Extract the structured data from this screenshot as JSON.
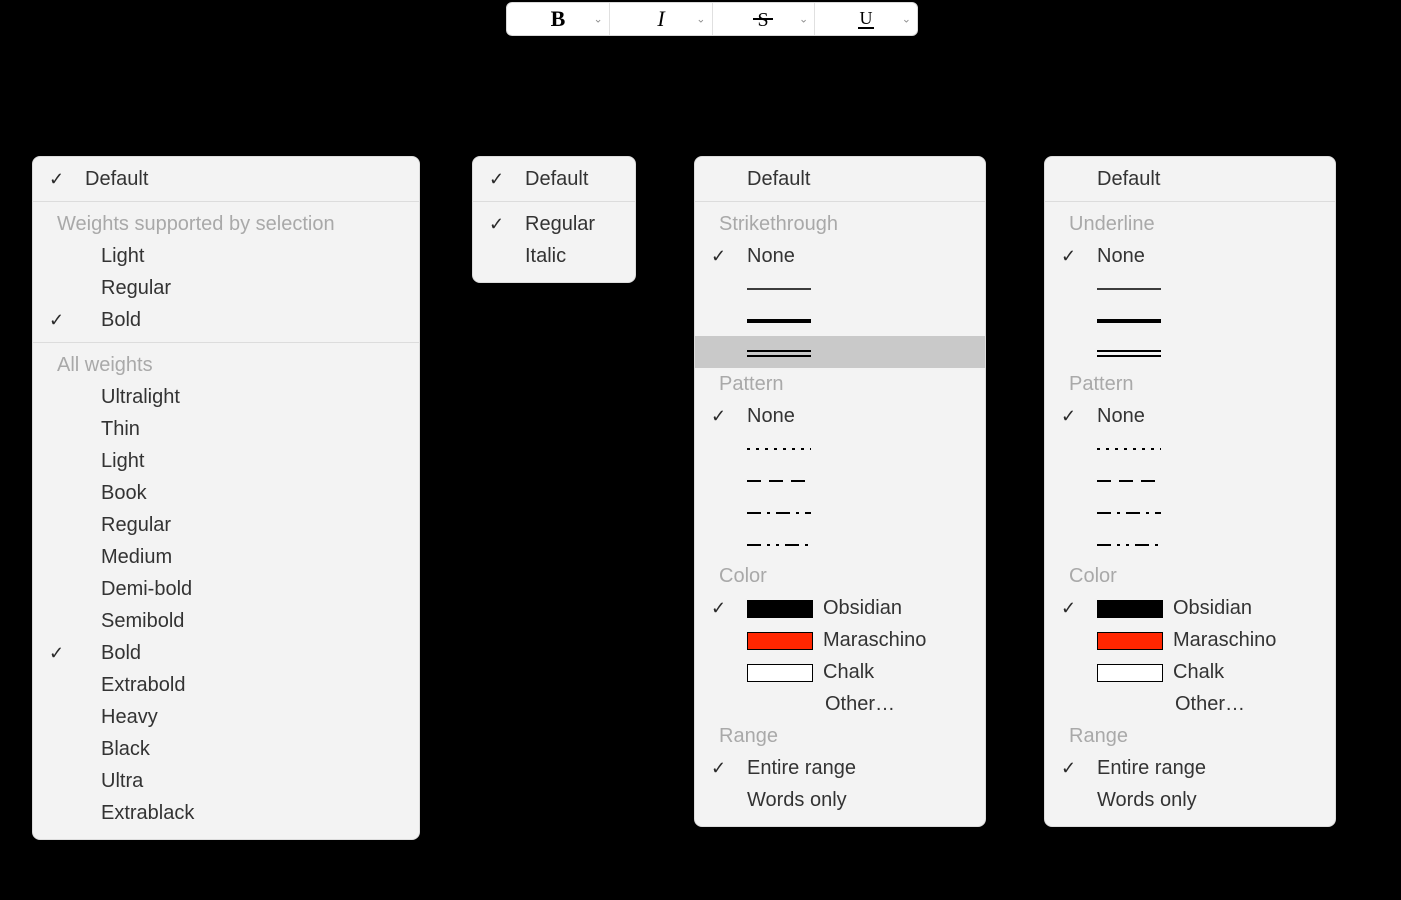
{
  "toolbar": {
    "segments": [
      {
        "name": "bold",
        "glyph": "B"
      },
      {
        "name": "italic",
        "glyph": "I"
      },
      {
        "name": "strikethrough",
        "glyph": "S"
      },
      {
        "name": "underline",
        "glyph": "U"
      }
    ]
  },
  "boldMenu": {
    "default": {
      "label": "Default",
      "checked": true
    },
    "supportedHeader": "Weights supported by selection",
    "supported": [
      {
        "label": "Light",
        "checked": false
      },
      {
        "label": "Regular",
        "checked": false
      },
      {
        "label": "Bold",
        "checked": true
      }
    ],
    "allHeader": "All weights",
    "all": [
      {
        "label": "Ultralight",
        "checked": false
      },
      {
        "label": "Thin",
        "checked": false
      },
      {
        "label": "Light",
        "checked": false
      },
      {
        "label": "Book",
        "checked": false
      },
      {
        "label": "Regular",
        "checked": false
      },
      {
        "label": "Medium",
        "checked": false
      },
      {
        "label": "Demi-bold",
        "checked": false
      },
      {
        "label": "Semibold",
        "checked": false
      },
      {
        "label": "Bold",
        "checked": true
      },
      {
        "label": "Extrabold",
        "checked": false
      },
      {
        "label": "Heavy",
        "checked": false
      },
      {
        "label": "Black",
        "checked": false
      },
      {
        "label": "Ultra",
        "checked": false
      },
      {
        "label": "Extrablack",
        "checked": false
      }
    ]
  },
  "italicMenu": {
    "default": {
      "label": "Default",
      "checked": true
    },
    "items": [
      {
        "label": "Regular",
        "checked": true
      },
      {
        "label": "Italic",
        "checked": false
      }
    ]
  },
  "strikeMenu": {
    "default": {
      "label": "Default",
      "checked": false
    },
    "styleHeader": "Strikethrough",
    "styles": [
      {
        "kind": "none",
        "label": "None",
        "checked": true,
        "hovered": false
      },
      {
        "kind": "thin",
        "checked": false,
        "hovered": false
      },
      {
        "kind": "thick",
        "checked": false,
        "hovered": false
      },
      {
        "kind": "double",
        "checked": false,
        "hovered": true
      }
    ],
    "patternHeader": "Pattern",
    "patterns": [
      {
        "kind": "none",
        "label": "None",
        "checked": true
      },
      {
        "kind": "dotted",
        "checked": false
      },
      {
        "kind": "dashed",
        "checked": false
      },
      {
        "kind": "dashdot",
        "checked": false
      },
      {
        "kind": "dashdot2",
        "checked": false
      }
    ],
    "colorHeader": "Color",
    "colors": [
      {
        "label": "Obsidian",
        "hex": "#000000",
        "checked": true
      },
      {
        "label": "Maraschino",
        "hex": "#ff2600",
        "checked": false
      },
      {
        "label": "Chalk",
        "hex": "#ffffff",
        "checked": false
      }
    ],
    "otherLabel": "Other…",
    "rangeHeader": "Range",
    "ranges": [
      {
        "label": "Entire range",
        "checked": true
      },
      {
        "label": "Words only",
        "checked": false
      }
    ]
  },
  "underlineMenu": {
    "default": {
      "label": "Default",
      "checked": false
    },
    "styleHeader": "Underline",
    "styles": [
      {
        "kind": "none",
        "label": "None",
        "checked": true
      },
      {
        "kind": "thin",
        "checked": false
      },
      {
        "kind": "thick",
        "checked": false
      },
      {
        "kind": "double",
        "checked": false
      }
    ],
    "patternHeader": "Pattern",
    "patterns": [
      {
        "kind": "none",
        "label": "None",
        "checked": true
      },
      {
        "kind": "dotted",
        "checked": false
      },
      {
        "kind": "dashed",
        "checked": false
      },
      {
        "kind": "dashdot",
        "checked": false
      },
      {
        "kind": "dashdot2",
        "checked": false
      }
    ],
    "colorHeader": "Color",
    "colors": [
      {
        "label": "Obsidian",
        "hex": "#000000",
        "checked": true
      },
      {
        "label": "Maraschino",
        "hex": "#ff2600",
        "checked": false
      },
      {
        "label": "Chalk",
        "hex": "#ffffff",
        "checked": false
      }
    ],
    "otherLabel": "Other…",
    "rangeHeader": "Range",
    "ranges": [
      {
        "label": "Entire range",
        "checked": true
      },
      {
        "label": "Words only",
        "checked": false
      }
    ]
  }
}
